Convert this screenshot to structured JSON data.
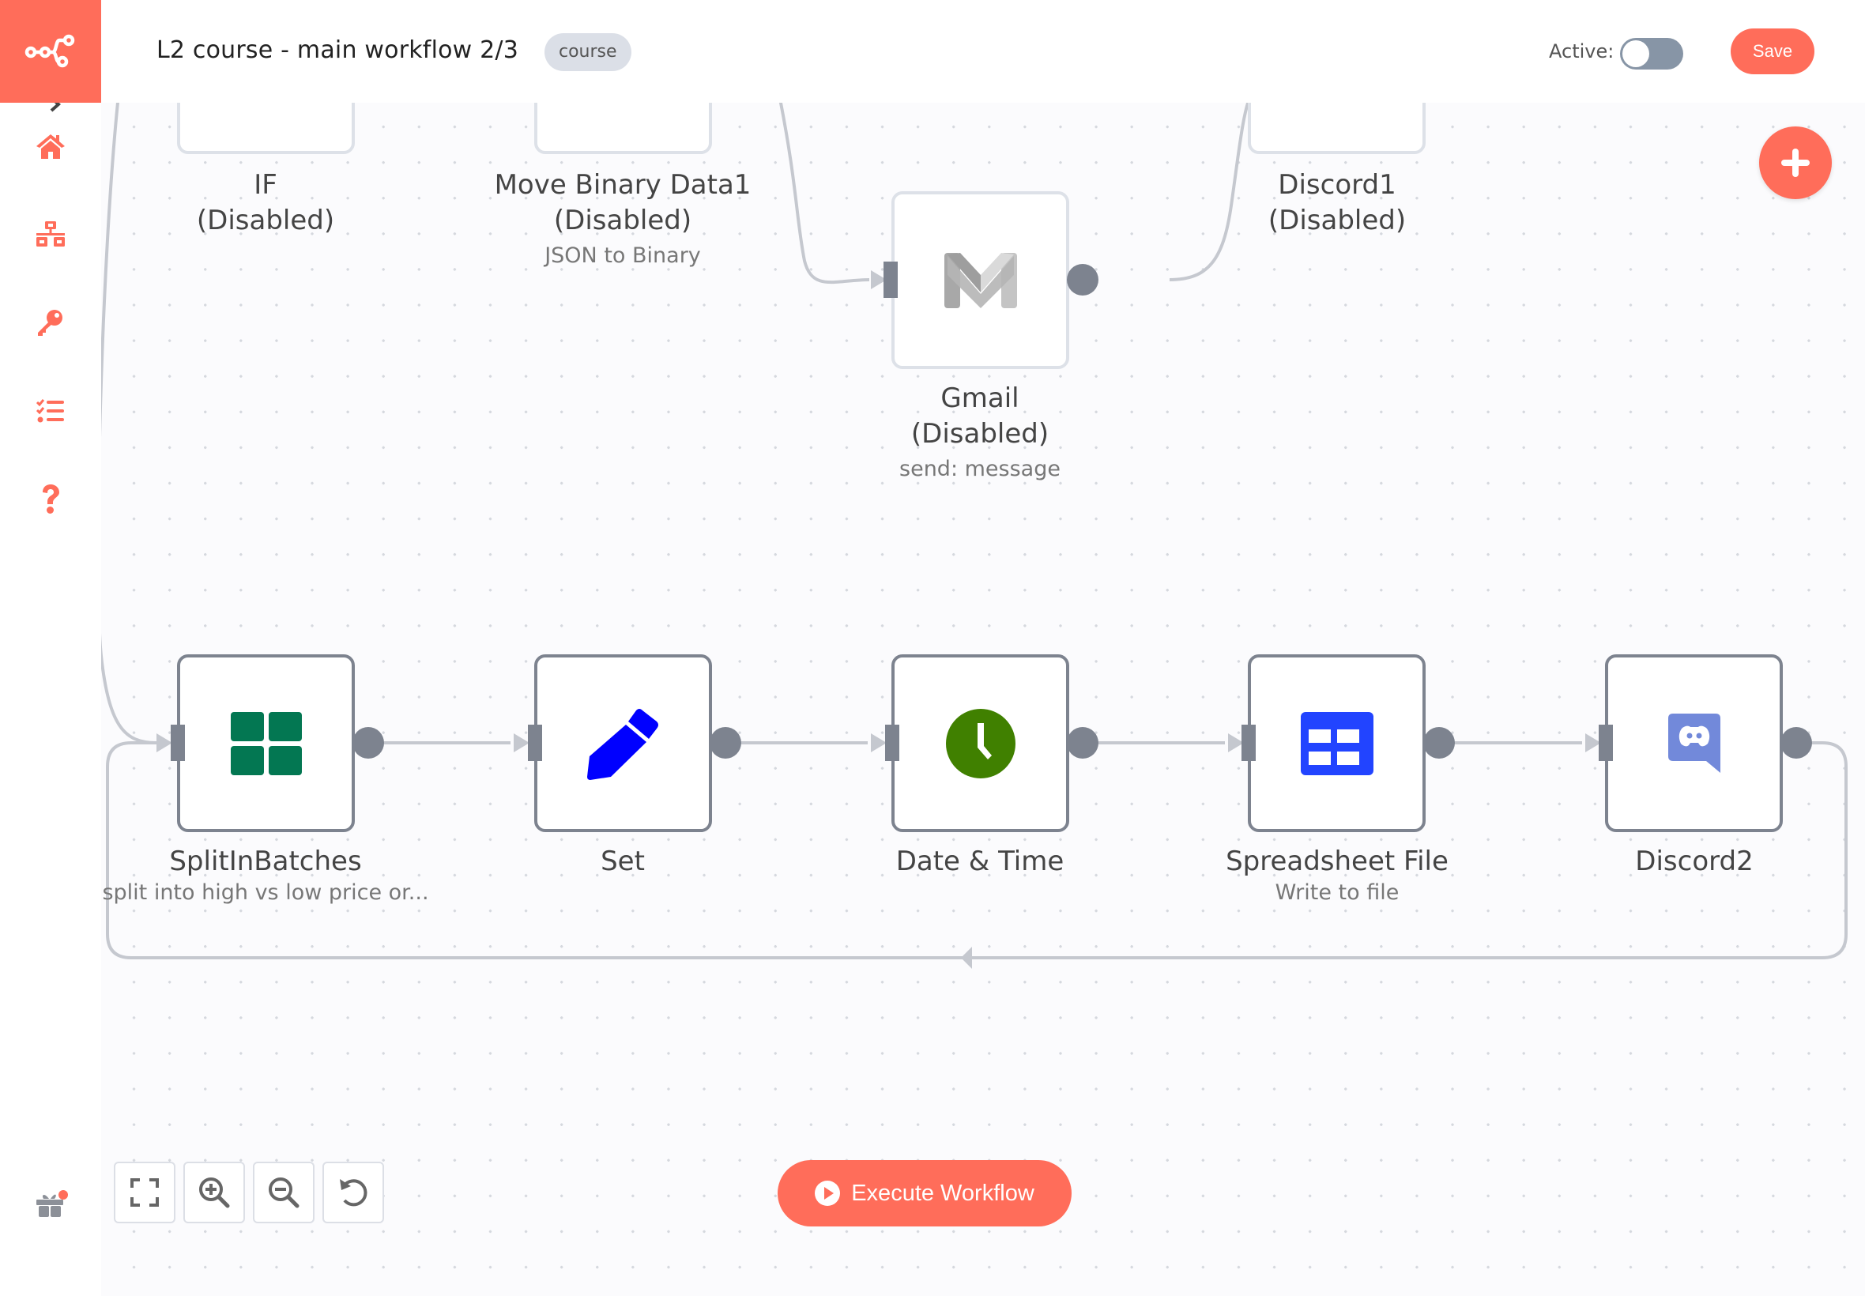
{
  "header": {
    "logo_icon": "n8n-logo-icon",
    "workflow_title": "L2 course - main workflow 2/3",
    "tag": "course",
    "active_label": "Active:",
    "active": false,
    "save_label": "Save"
  },
  "sidebar": {
    "collapse_icon": "chevron-right-icon",
    "items": [
      {
        "name": "home",
        "icon": "home-icon"
      },
      {
        "name": "workflows",
        "icon": "network-icon"
      },
      {
        "name": "credentials",
        "icon": "key-icon"
      },
      {
        "name": "executions",
        "icon": "tasks-icon"
      },
      {
        "name": "help",
        "icon": "question-icon"
      }
    ],
    "updates_icon": "gift-icon",
    "updates_notification": true
  },
  "colors": {
    "accent": "#FF6D5A",
    "node_border": "#7D838F",
    "disabled_border": "#DDE1E8",
    "edge": "#C5C8CF",
    "canvas": "#FBFBFD"
  },
  "nodes": {
    "if": {
      "name": "IF",
      "status": "(Disabled)",
      "output_label": "false"
    },
    "move_binary": {
      "name": "Move Binary Data1",
      "status": "(Disabled)",
      "subtitle": "JSON to Binary"
    },
    "gmail": {
      "name": "Gmail",
      "status": "(Disabled)",
      "subtitle": "send: message"
    },
    "discord1": {
      "name": "Discord1",
      "status": "(Disabled)"
    },
    "split": {
      "name": "SplitInBatches",
      "subtitle": "split into high vs low price or..."
    },
    "set": {
      "name": "Set"
    },
    "datetime": {
      "name": "Date & Time"
    },
    "spreadsheet": {
      "name": "Spreadsheet File",
      "subtitle": "Write to file"
    },
    "discord2": {
      "name": "Discord2"
    }
  },
  "controls": {
    "zoom_to_fit": "fullscreen-icon",
    "zoom_in": "zoom-in-icon",
    "zoom_out": "zoom-out-icon",
    "reset": "undo-icon",
    "execute_label": "Execute Workflow"
  }
}
